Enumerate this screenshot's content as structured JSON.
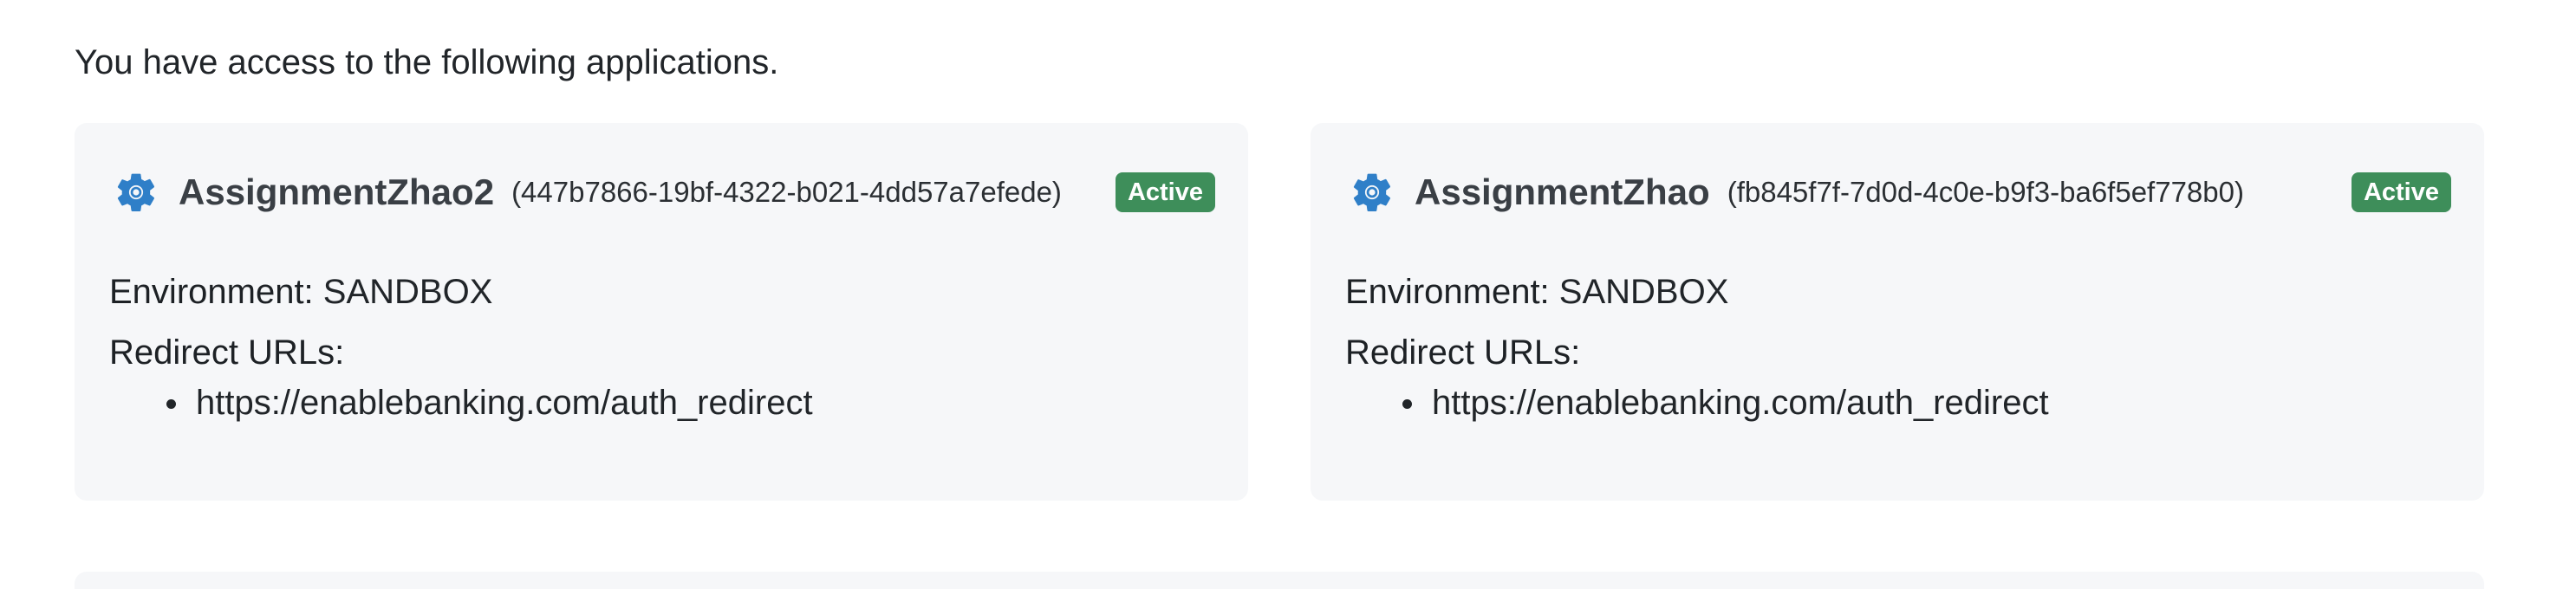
{
  "intro_text": "You have access to the following applications.",
  "colors": {
    "card_background": "#f6f7f9",
    "active_badge": "#3e8e5a",
    "gear_icon": "#2f7fc8"
  },
  "applications": [
    {
      "icon": "gear-icon",
      "name": "AssignmentZhao2",
      "id": "(447b7866-19bf-4322-b021-4dd57a7efede)",
      "status": "Active",
      "environment_label": "Environment:",
      "environment_value": "SANDBOX",
      "redirect_label": "Redirect URLs:",
      "redirect_urls": [
        "https://enablebanking.com/auth_redirect"
      ]
    },
    {
      "icon": "gear-icon",
      "name": "AssignmentZhao",
      "id": "(fb845f7f-7d0d-4c0e-b9f3-ba6f5ef778b0)",
      "status": "Active",
      "environment_label": "Environment:",
      "environment_value": "SANDBOX",
      "redirect_label": "Redirect URLs:",
      "redirect_urls": [
        "https://enablebanking.com/auth_redirect"
      ]
    }
  ]
}
